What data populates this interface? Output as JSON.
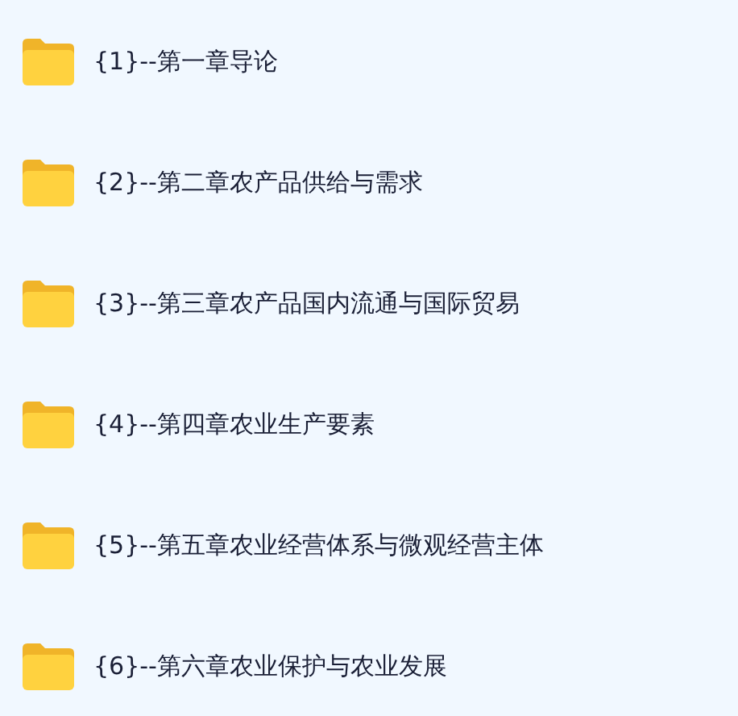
{
  "folders": [
    {
      "name": "{1}--第一章导论"
    },
    {
      "name": "{2}--第二章农产品供给与需求"
    },
    {
      "name": "{3}--第三章农产品国内流通与国际贸易"
    },
    {
      "name": "{4}--第四章农业生产要素"
    },
    {
      "name": "{5}--第五章农业经营体系与微观经营主体"
    },
    {
      "name": "{6}--第六章农业保护与农业发展"
    }
  ]
}
